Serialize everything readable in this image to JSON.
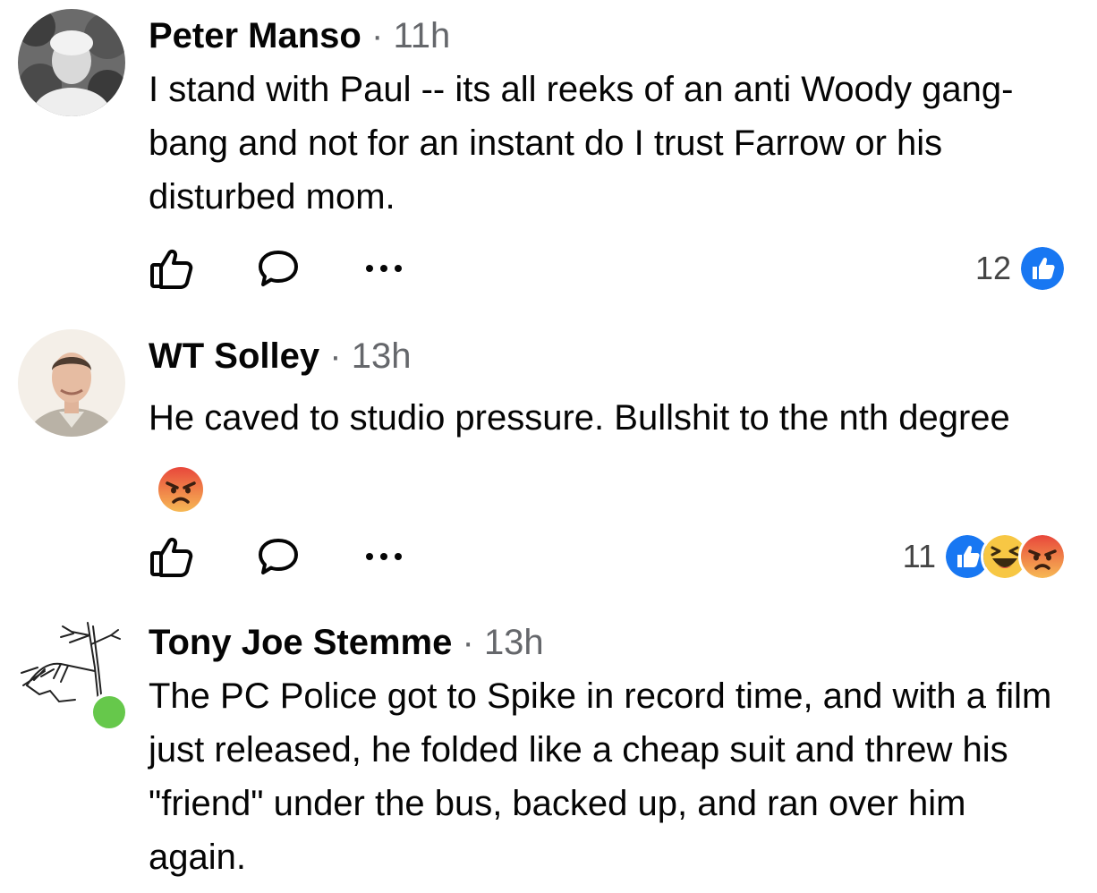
{
  "comments": [
    {
      "name": "Peter Manso",
      "separator": "·",
      "time": "11h",
      "text": "I stand with Paul -- its all reeks of an anti Woody gang-bang and not for an instant do I trust Farrow or his disturbed mom.",
      "reaction_count": "12",
      "reactions": [
        "like"
      ]
    },
    {
      "name": "WT Solley",
      "separator": "·",
      "time": "13h",
      "text": "He caved to studio pressure.  Bullshit to the nth degree",
      "inline_emoji": "angry",
      "reaction_count": "11",
      "reactions": [
        "like",
        "haha",
        "angry"
      ]
    },
    {
      "name": "Tony Joe Stemme",
      "separator": "·",
      "time": "13h",
      "text": "The PC Police got to Spike in record time, and with a film just released, he folded like a cheap suit and threw his \"friend\" under the bus, backed up, and ran over him again.",
      "online": true
    }
  ],
  "colors": {
    "like_blue": "#1877f2",
    "online_green": "#66c84b",
    "meta_gray": "#65676b"
  }
}
